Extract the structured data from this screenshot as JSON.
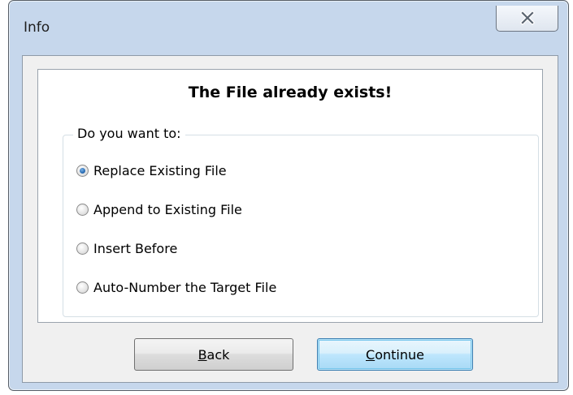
{
  "window": {
    "title": "Info"
  },
  "dialog": {
    "heading": "The File already exists!",
    "group_label": "Do you want to:",
    "options": [
      {
        "label": "Replace Existing File",
        "checked": true
      },
      {
        "label": "Append to Existing File",
        "checked": false
      },
      {
        "label": "Insert Before",
        "checked": false
      },
      {
        "label": "Auto-Number the Target File",
        "checked": false
      }
    ]
  },
  "buttons": {
    "back": {
      "mnemonic": "B",
      "rest": "ack"
    },
    "continue": {
      "mnemonic": "C",
      "rest": "ontinue"
    }
  },
  "colors": {
    "frame": "#c6d7ec",
    "client": "#f0f0f0",
    "default_button_border": "#3c7fb1"
  }
}
